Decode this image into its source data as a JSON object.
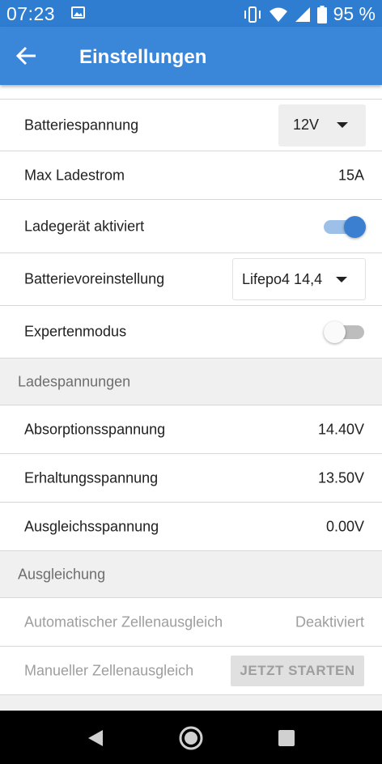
{
  "status_bar": {
    "time": "07:23",
    "battery_percent": "95 %",
    "icons": [
      "image-icon",
      "vibrate-icon",
      "wifi-icon",
      "signal-icon",
      "battery-icon"
    ]
  },
  "app_bar": {
    "title": "Einstellungen",
    "back_icon": "arrow-back-icon"
  },
  "settings": {
    "batteriespannung": {
      "label": "Batteriespannung",
      "value": "12V"
    },
    "max_ladestrom": {
      "label": "Max Ladestrom",
      "value": "15A"
    },
    "ladegeraet": {
      "label": "Ladegerät aktiviert",
      "enabled": true
    },
    "batterievoreinstellung": {
      "label": "Batterievoreinstellung",
      "value": "Lifepo4 14,4"
    },
    "expertenmodus": {
      "label": "Expertenmodus",
      "enabled": false
    }
  },
  "ladespannungen": {
    "title": "Ladespannungen",
    "absorption": {
      "label": "Absorptionsspannung",
      "value": "14.40V"
    },
    "erhaltung": {
      "label": "Erhaltungsspannung",
      "value": "13.50V"
    },
    "ausgleich": {
      "label": "Ausgleichsspannung",
      "value": "0.00V"
    }
  },
  "ausgleichung": {
    "title": "Ausgleichung",
    "automatisch": {
      "label": "Automatischer Zellenausgleich",
      "value": "Deaktiviert"
    },
    "manuell": {
      "label": "Manueller Zellenausgleich",
      "button": "JETZT STARTEN"
    }
  },
  "colors": {
    "primary": "#3a86d8",
    "status_bar": "#2f7dd1",
    "switch_on": "#3a7fd0",
    "section_bg": "#f0f0f0"
  },
  "nav_bar": {
    "icons": [
      "back-triangle-icon",
      "home-circle-icon",
      "recents-square-icon"
    ]
  }
}
